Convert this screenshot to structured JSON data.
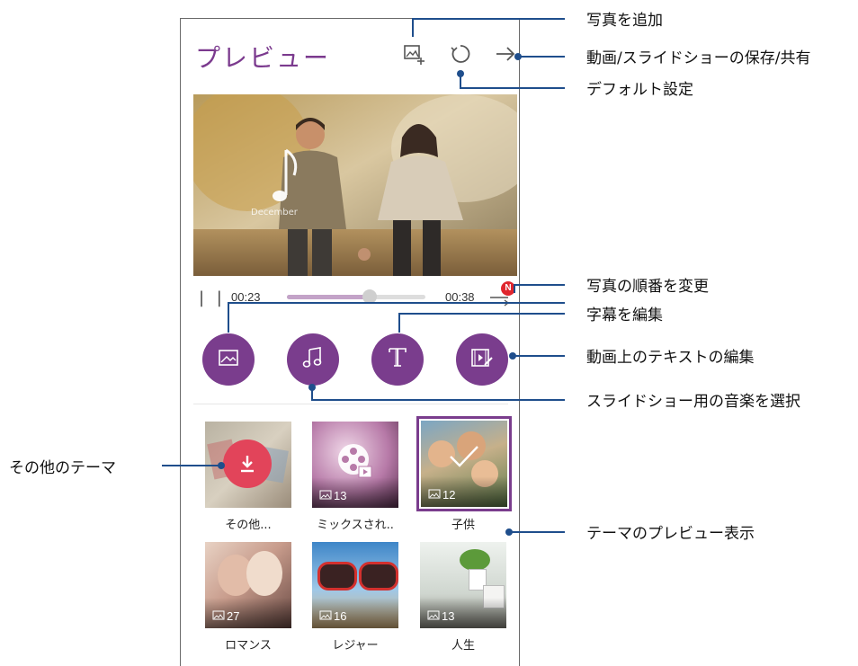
{
  "screen": {
    "title": "プレビュー",
    "toolbar": {
      "add_photo_icon": "add-photo-icon",
      "reset_icon": "reset-icon",
      "share_icon": "share-arrow-icon"
    }
  },
  "player": {
    "elapsed": "00:23",
    "total": "00:38",
    "progress": 0.6,
    "photo_caption": "December",
    "reorder_badge": "N"
  },
  "actions": [
    {
      "name": "image-edit-button",
      "icon": "image-icon"
    },
    {
      "name": "music-button",
      "icon": "music-note-icon"
    },
    {
      "name": "text-button",
      "icon": "text-t-icon"
    },
    {
      "name": "video-text-button",
      "icon": "film-edit-icon"
    }
  ],
  "themes": [
    {
      "label": "その他...",
      "count": ""
    },
    {
      "label": "ミックスされ..",
      "count": "13"
    },
    {
      "label": "子供",
      "count": "12",
      "selected": true
    },
    {
      "label": "ロマンス",
      "count": "27"
    },
    {
      "label": "レジャー",
      "count": "16"
    },
    {
      "label": "人生",
      "count": "13"
    }
  ],
  "callouts": {
    "add_photo": "写真を追加",
    "save_share": "動画/スライドショーの保存/共有",
    "default_settings": "デフォルト設定",
    "reorder_photos": "写真の順番を変更",
    "edit_captions": "字幕を編集",
    "edit_video_text": "動画上のテキストの編集",
    "select_music": "スライドショー用の音楽を選択",
    "more_themes": "その他のテーマ",
    "theme_preview": "テーマのプレビュー表示"
  },
  "colors": {
    "accent": "#7a3d8d",
    "callout": "#1f4e8c",
    "title": "#7b3a8e",
    "badge": "#e0262e"
  }
}
